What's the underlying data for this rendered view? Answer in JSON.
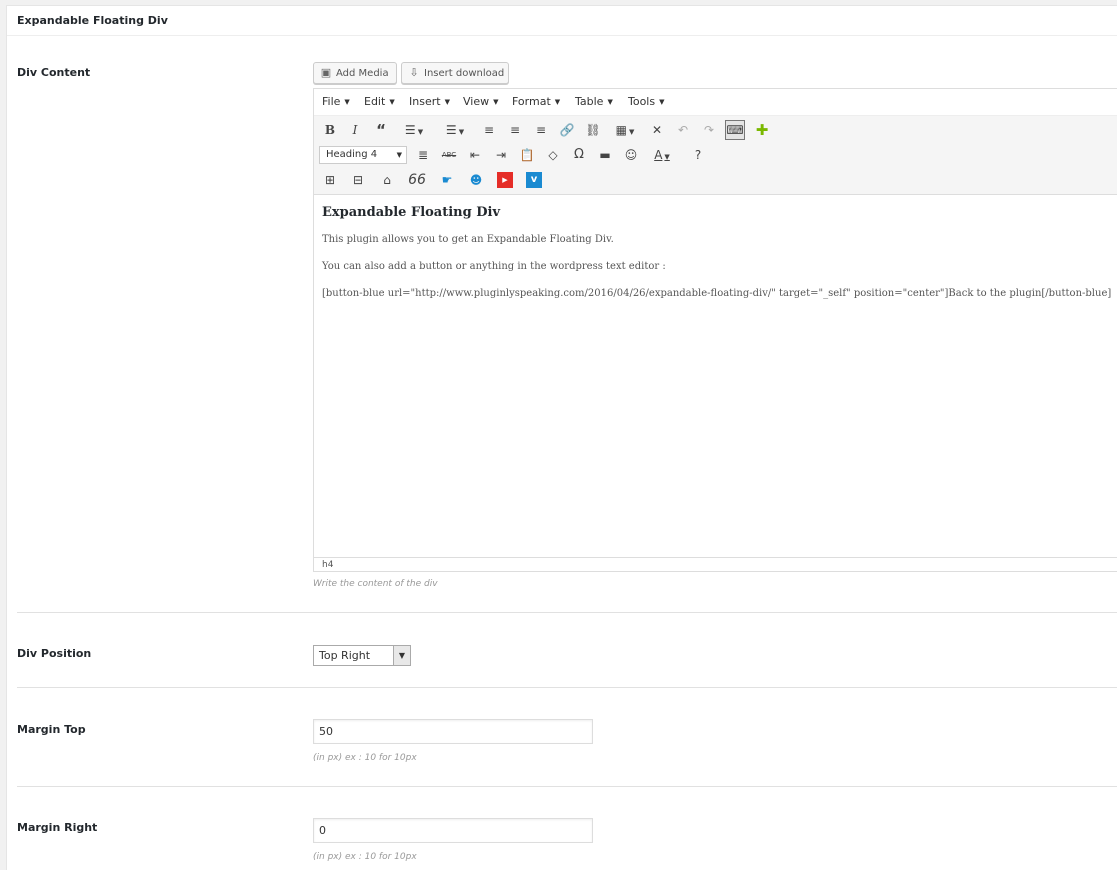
{
  "panel": {
    "title": "Expandable Floating Div"
  },
  "div_content": {
    "label": "Div Content",
    "add_media": "Add Media",
    "insert_download": "Insert download",
    "menu": [
      "File",
      "Edit",
      "Insert",
      "View",
      "Format",
      "Table",
      "Tools"
    ],
    "format_select": "Heading 4",
    "icons_row1": [
      "bold-icon",
      "italic-icon",
      "blockquote-icon",
      "bullet-list-icon",
      "numbered-list-icon",
      "align-left-icon",
      "align-center-icon",
      "align-right-icon",
      "link-icon",
      "unlink-icon",
      "table-icon",
      "fullscreen-icon",
      "undo-icon",
      "redo-icon",
      "toolbar-toggle-icon",
      "plus-icon"
    ],
    "icons_row2": [
      "justify-icon",
      "strikethrough-icon",
      "outdent-icon",
      "indent-icon",
      "paste-text-icon",
      "eraser-icon",
      "omega-icon",
      "horizontal-rule-icon",
      "emoticon-icon",
      "text-color-icon",
      "help-icon"
    ],
    "icons_row3": [
      "grid-icon",
      "page-break-icon",
      "hat-icon",
      "quote-icon",
      "hand-pointer-icon",
      "smiley-icon",
      "youtube-icon",
      "vimeo-icon"
    ],
    "editor": {
      "heading": "Expandable Floating Div",
      "p1": "This plugin allows you to get an Expandable Floating Div.",
      "p2": "You can also add a button or anything in the wordpress text editor :",
      "p3": "[button-blue url=\"http://www.pluginlyspeaking.com/2016/04/26/expandable-floating-div/\" target=\"_self\" position=\"center\"]Back to the plugin[/button-blue]"
    },
    "status_path": "h4",
    "description": "Write the content of the div"
  },
  "div_position": {
    "label": "Div Position",
    "value": "Top Right"
  },
  "margin_top": {
    "label": "Margin Top",
    "value": "50",
    "description": "(in px) ex : 10 for 10px"
  },
  "margin_right": {
    "label": "Margin Right",
    "value": "0",
    "description": "(in px) ex : 10 for 10px"
  },
  "colors": {
    "accent_green": "#7ab800",
    "youtube_red": "#e52d27",
    "vimeo_blue": "#1ab7ea"
  }
}
